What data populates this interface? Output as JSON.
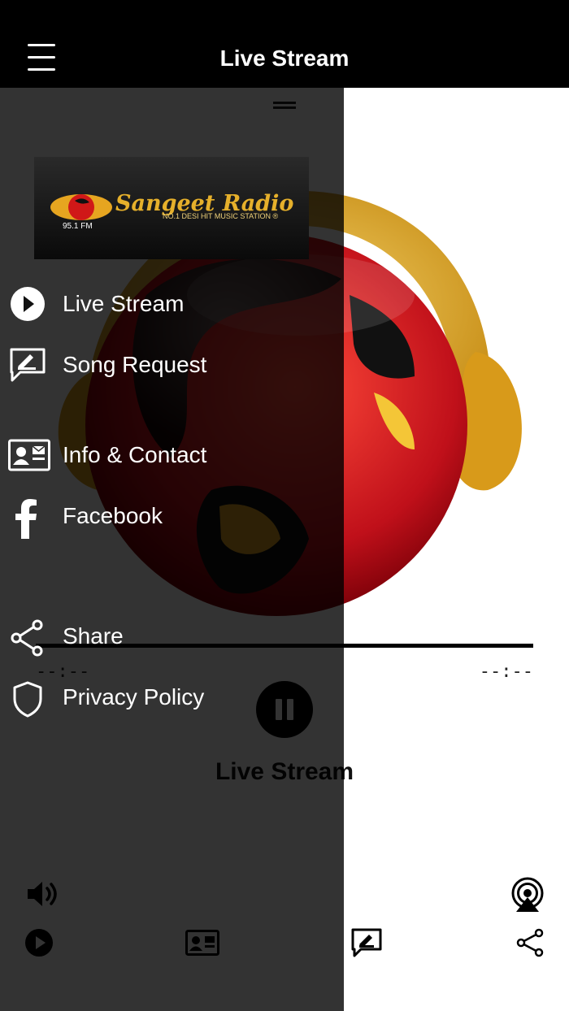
{
  "header": {
    "title": "Live Stream"
  },
  "player": {
    "elapsed": "--:--",
    "remaining": "--:--",
    "now_playing": "Live Stream",
    "progress": 0
  },
  "logo": {
    "title": "Sangeet Radio",
    "tagline": "NO.1 DESI HIT MUSIC STATION ®",
    "frequency": "95.1 FM"
  },
  "drawer": {
    "items": [
      {
        "label": "Live Stream",
        "icon": "play-circle-icon"
      },
      {
        "label": "Song Request",
        "icon": "edit-message-icon"
      },
      {
        "label": "Info & Contact",
        "icon": "contact-card-icon"
      },
      {
        "label": "Facebook",
        "icon": "facebook-icon"
      },
      {
        "label": "Share",
        "icon": "share-icon"
      },
      {
        "label": "Privacy Policy",
        "icon": "shield-icon"
      }
    ]
  },
  "colors": {
    "header": "#000000",
    "gold": "#e6a520",
    "red": "#d01818",
    "overlay": "rgba(0,0,0,0.80)"
  }
}
